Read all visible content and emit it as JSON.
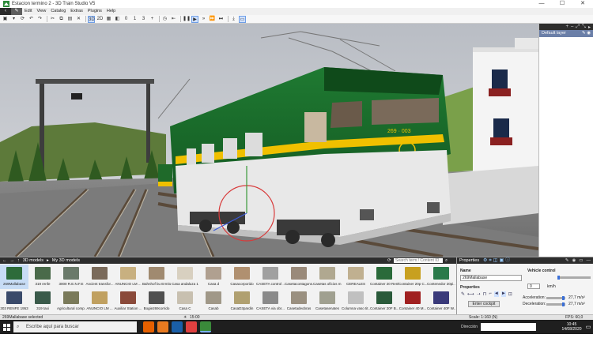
{
  "window": {
    "title": "Estacion termino 2 - 3D Train Studio V5",
    "controls": [
      "—",
      "☐",
      "✕"
    ]
  },
  "menu": {
    "modes": [
      "‹",
      "✎"
    ],
    "items": [
      "Edit",
      "View",
      "Catalog",
      "Extras",
      "Plugins",
      "Help"
    ]
  },
  "toolbar": {
    "view_3d": "3D",
    "view_2d": "2D",
    "value_0": "0",
    "value_1": "1",
    "value_3": "3"
  },
  "layers": {
    "default_layer": "Default layer",
    "toolbar_icons": [
      "+",
      "–",
      "⤢",
      "⤡",
      "▸"
    ]
  },
  "catalog": {
    "breadcrumb_root": "3D models",
    "breadcrumb_sep": "▸",
    "breadcrumb_current": "My 3D models",
    "search_placeholder": "Search term / Content ID",
    "items": [
      {
        "label": "269Mallabase",
        "color": "#2d6b3a",
        "selected": true
      },
      {
        "label": "319 renfe",
        "color": "#4a6a4a"
      },
      {
        "label": "3000 R.E.N.F.E",
        "color": "#6a7a6a"
      },
      {
        "label": "Ancient transfor...",
        "color": "#7a6a5a"
      },
      {
        "label": "ANUNCIO LM ...",
        "color": "#c8b080"
      },
      {
        "label": "Bahnhof bu Ermita",
        "color": "#a08a70"
      },
      {
        "label": "Casa andaluza 1",
        "color": "#d8d0c0"
      },
      {
        "label": "Casa d",
        "color": "#b0a090"
      },
      {
        "label": "Casacorporido",
        "color": "#b09070"
      },
      {
        "label": "CASETA control ...",
        "color": "#a0a0a0"
      },
      {
        "label": "Casetacontagons...",
        "color": "#9a8a7a"
      },
      {
        "label": "Casetas oficios m...",
        "color": "#b0a890"
      },
      {
        "label": "CEREALES",
        "color": "#c0b090"
      },
      {
        "label": "Container 20 Renfe",
        "color": "#2a6a3a"
      },
      {
        "label": "Container 20p C...",
        "color": "#c8a020"
      },
      {
        "label": "Contenedor 20pi...",
        "color": "#2a7a4a"
      },
      {
        "label": "303 RENFE 1953",
        "color": "#3a4a6a"
      },
      {
        "label": "319 taxi",
        "color": "#3a5a4a"
      },
      {
        "label": "Agricultural comp...",
        "color": "#7a7a5a"
      },
      {
        "label": "ANUNCIO LM ...",
        "color": "#c0a060"
      },
      {
        "label": "Auxiliar Station ...",
        "color": "#8a4a3a"
      },
      {
        "label": "Bogie269corrido",
        "color": "#505050"
      },
      {
        "label": "Casa C",
        "color": "#c8c0b0"
      },
      {
        "label": "Casab",
        "color": "#a09888"
      },
      {
        "label": "CasaD3pardin",
        "color": "#b0a070"
      },
      {
        "label": "CASETA via obr...",
        "color": "#8a8a8a"
      },
      {
        "label": "Casetadeobras",
        "color": "#9a9080"
      },
      {
        "label": "Casetasenates",
        "color": "#a0a090"
      },
      {
        "label": "Columna vaso tit...",
        "color": "#c0c0c0"
      },
      {
        "label": "Container 20F B...",
        "color": "#2a5a3a"
      },
      {
        "label": "Container 40 M...",
        "color": "#a02020"
      },
      {
        "label": "Container 40F W...",
        "color": "#3a3a7a"
      },
      {
        "label": "CONTENEDOR...",
        "color": "#2a3a8a"
      }
    ]
  },
  "properties": {
    "title": "Properties",
    "name_label": "Name",
    "name_value": "269Mallabase",
    "section_label": "Properties",
    "cockpit_button": "Enter cockpit",
    "vehicle_control_label": "Vehicle control",
    "speed_value": "0",
    "speed_unit": "km/h",
    "acceleration_label": "Acceleration:",
    "acceleration_value": "27,7 m/s²",
    "deceleration_label": "Deceleration:",
    "deceleration_value": "27,7 m/s²",
    "vehicle_control_level": 0.0,
    "acceleration_level": 0.9,
    "deceleration_level": 0.9
  },
  "status": {
    "selection": "269Mallabase selected",
    "time": "15:00",
    "scale": "Scale: 1:160 (N)",
    "fps": "FPS: 60,0"
  },
  "taskbar": {
    "search_placeholder": "Escribe aquí para buscar",
    "direction_label": "Dirección",
    "clock_time": "10:45",
    "clock_date": "14/08/2020"
  },
  "train": {
    "number": "269 · 003",
    "body_color": "#1e6a2a",
    "stripe_color": "#f0c000"
  }
}
